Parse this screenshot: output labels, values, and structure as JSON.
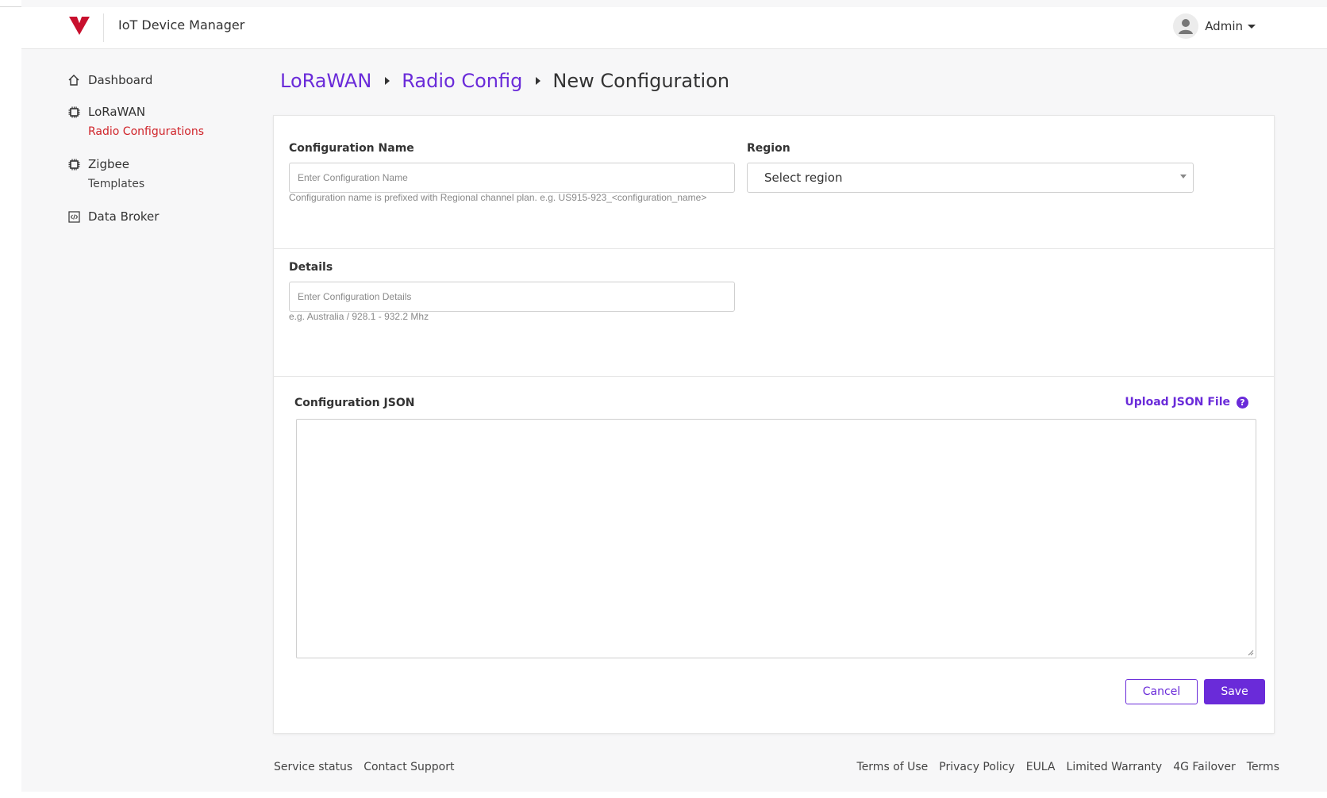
{
  "header": {
    "app_title": "IoT Device Manager",
    "user_name": "Admin"
  },
  "sidebar": {
    "items": [
      {
        "label": "Dashboard",
        "icon": "home-icon"
      },
      {
        "label": "LoRaWAN",
        "icon": "chip-icon",
        "sub": [
          {
            "label": "Radio Configurations",
            "active": true
          }
        ]
      },
      {
        "label": "Zigbee",
        "icon": "chip-icon",
        "sub": [
          {
            "label": "Templates",
            "active": false
          }
        ]
      },
      {
        "label": "Data Broker",
        "icon": "code-box-icon"
      }
    ]
  },
  "breadcrumb": {
    "items": [
      "LoRaWAN",
      "Radio Config"
    ],
    "current": "New Configuration"
  },
  "form": {
    "config_name": {
      "label": "Configuration Name",
      "placeholder": "Enter Configuration Name",
      "value": "",
      "help": "Configuration name is prefixed with Regional channel plan. e.g. US915-923_<configuration_name>"
    },
    "region": {
      "label": "Region",
      "selected": "Select region"
    },
    "details": {
      "label": "Details",
      "placeholder": "Enter Configuration Details",
      "value": "",
      "help": "e.g. Australia / 928.1 - 932.2 Mhz"
    },
    "json": {
      "label": "Configuration JSON",
      "upload_label": "Upload JSON File",
      "help_icon": "?",
      "value": ""
    },
    "cancel_label": "Cancel",
    "save_label": "Save"
  },
  "footer": {
    "left": [
      "Service status",
      "Contact Support"
    ],
    "right": [
      "Terms of Use",
      "Privacy Policy",
      "EULA",
      "Limited Warranty",
      "4G Failover",
      "Terms"
    ]
  },
  "colors": {
    "accent": "#6a2bd9",
    "active_nav": "#d0242a",
    "brand": "#c8102e"
  }
}
